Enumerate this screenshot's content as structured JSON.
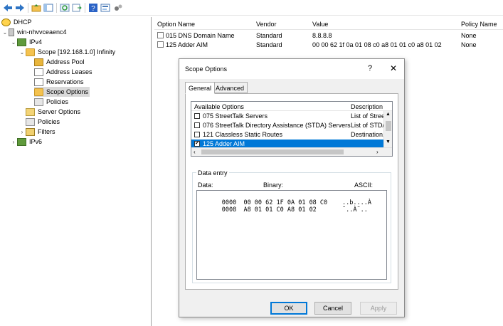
{
  "toolbar": {
    "buttons": [
      "back-arrow-icon",
      "forward-arrow-icon",
      "folder-up-icon",
      "show-hide-tree-icon",
      "refresh-icon",
      "export-list-icon",
      "help-icon",
      "properties-icon",
      "options-icon"
    ]
  },
  "tree": {
    "dhcp": "DHCP",
    "server": "win-nhvvceaenc4",
    "ipv4": "IPv4",
    "scope": "Scope [192.168.1.0] Infinity",
    "address_pool": "Address Pool",
    "address_leases": "Address Leases",
    "reservations": "Reservations",
    "scope_options": "Scope Options",
    "scope_policies": "Policies",
    "server_options": "Server Options",
    "policies": "Policies",
    "filters": "Filters",
    "ipv6": "IPv6"
  },
  "list": {
    "headers": {
      "option_name": "Option Name",
      "vendor": "Vendor",
      "value": "Value",
      "policy_name": "Policy Name"
    },
    "rows": [
      {
        "option_name": "015 DNS Domain Name",
        "vendor": "Standard",
        "value": "8.8.8.8",
        "policy_name": "None"
      },
      {
        "option_name": "125 Adder AIM",
        "vendor": "Standard",
        "value": "00 00 62 1f 0a 01 08 c0 a8 01 01 c0 a8 01 02",
        "policy_name": "None"
      }
    ]
  },
  "dialog": {
    "title": "Scope Options",
    "help": "?",
    "close": "✕",
    "tabs": [
      "General",
      "Advanced"
    ],
    "options_header": {
      "name": "Available Options",
      "description": "Description"
    },
    "options": [
      {
        "name": "075 StreetTalk Servers",
        "description": "List of Stree",
        "checked": false
      },
      {
        "name": "076 StreetTalk Directory Assistance (STDA) Servers",
        "description": "List of STD/",
        "checked": false
      },
      {
        "name": "121 Classless Static Routes",
        "description": "Destination, ",
        "checked": false
      },
      {
        "name": "125 Adder AIM",
        "description": "",
        "checked": true
      }
    ],
    "data_entry": {
      "title": "Data entry",
      "labels": {
        "data": "Data:",
        "binary": "Binary:",
        "ascii": "ASCII:"
      },
      "lines": [
        {
          "offset": "0000",
          "hex": "00 00 62 1F 0A 01 08 C0",
          "ascii": "..b....À"
        },
        {
          "offset": "0008",
          "hex": "A8 01 01 C0 A8 01 02",
          "ascii": "¨..À¨.."
        }
      ]
    },
    "buttons": {
      "ok": "OK",
      "cancel": "Cancel",
      "apply": "Apply"
    }
  }
}
